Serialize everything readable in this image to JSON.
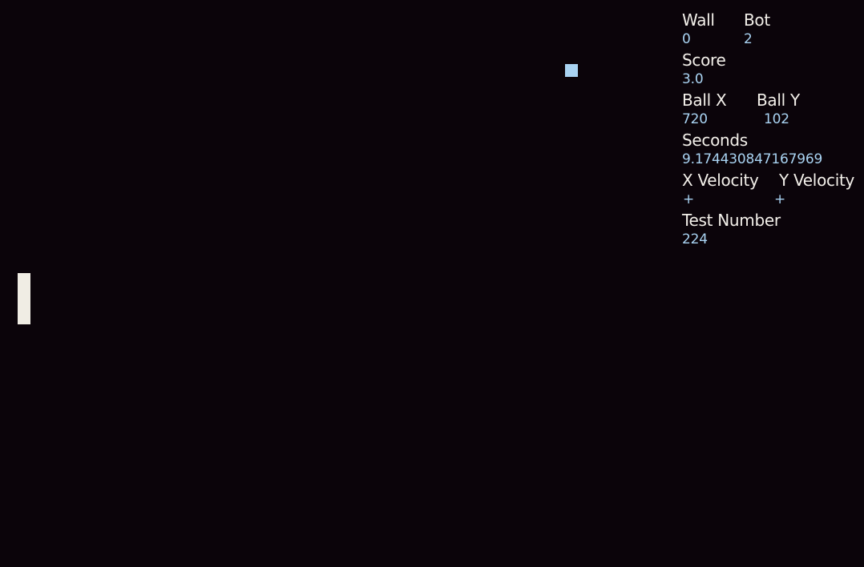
{
  "hud": {
    "wall_label": "Wall",
    "wall_value": "0",
    "bot_label": "Bot",
    "bot_value": "2",
    "score_label": "Score",
    "score_value": "3.0",
    "ball_x_label": "Ball X",
    "ball_x_value": "720",
    "ball_y_label": "Ball Y",
    "ball_y_value": "102",
    "seconds_label": "Seconds",
    "seconds_value": "9.174430847167969",
    "x_velocity_label": "X Velocity",
    "x_velocity_value": "+",
    "y_velocity_label": "Y Velocity",
    "y_velocity_value": "+",
    "test_number_label": "Test Number",
    "test_number_value": "224"
  },
  "colors": {
    "background": "#0b040a",
    "paddle": "#f0ede4",
    "ball": "#a9d3f2",
    "label": "#f3f0ea",
    "value": "#a9d3f2"
  }
}
